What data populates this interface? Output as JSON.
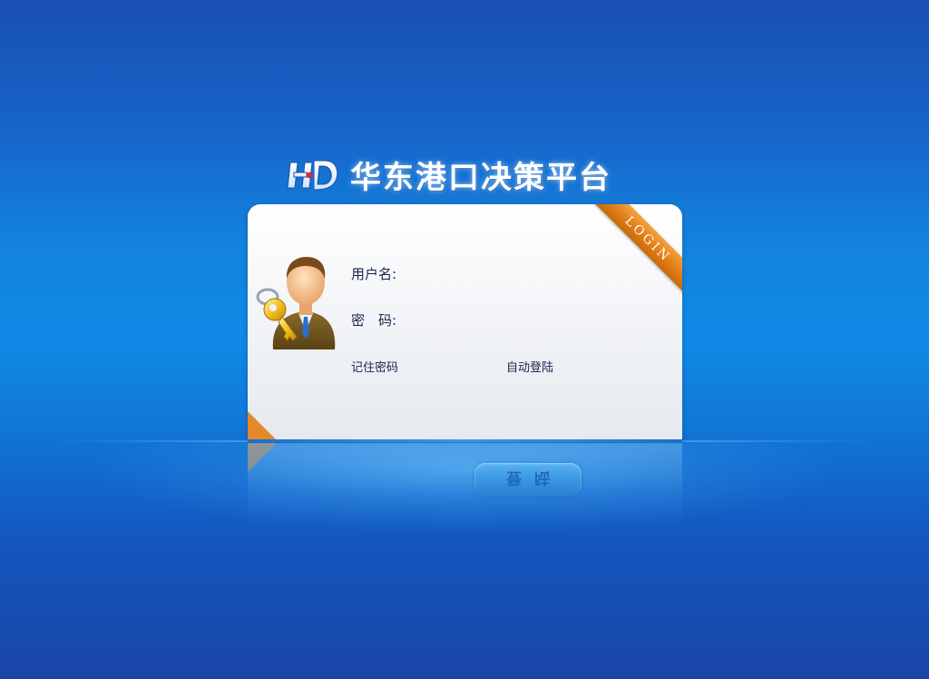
{
  "app": {
    "title": "华东港口决策平台",
    "logo_text": "HD"
  },
  "card": {
    "ribbon_label": "LOGIN",
    "username": {
      "label": "用户名:",
      "value": "",
      "placeholder": ""
    },
    "password": {
      "label": "密　码:",
      "value": "",
      "placeholder": ""
    },
    "remember_label": "记住密码",
    "auto_login_label": "自动登陆"
  },
  "login_button": {
    "label": "登陆"
  },
  "colors": {
    "background_top": "#1a4fb2",
    "background_mid": "#0f8be6",
    "ribbon": "#e07d16",
    "text": "#1b2350"
  },
  "icons": [
    "hd-logo-icon",
    "user-key-avatar-icon"
  ]
}
